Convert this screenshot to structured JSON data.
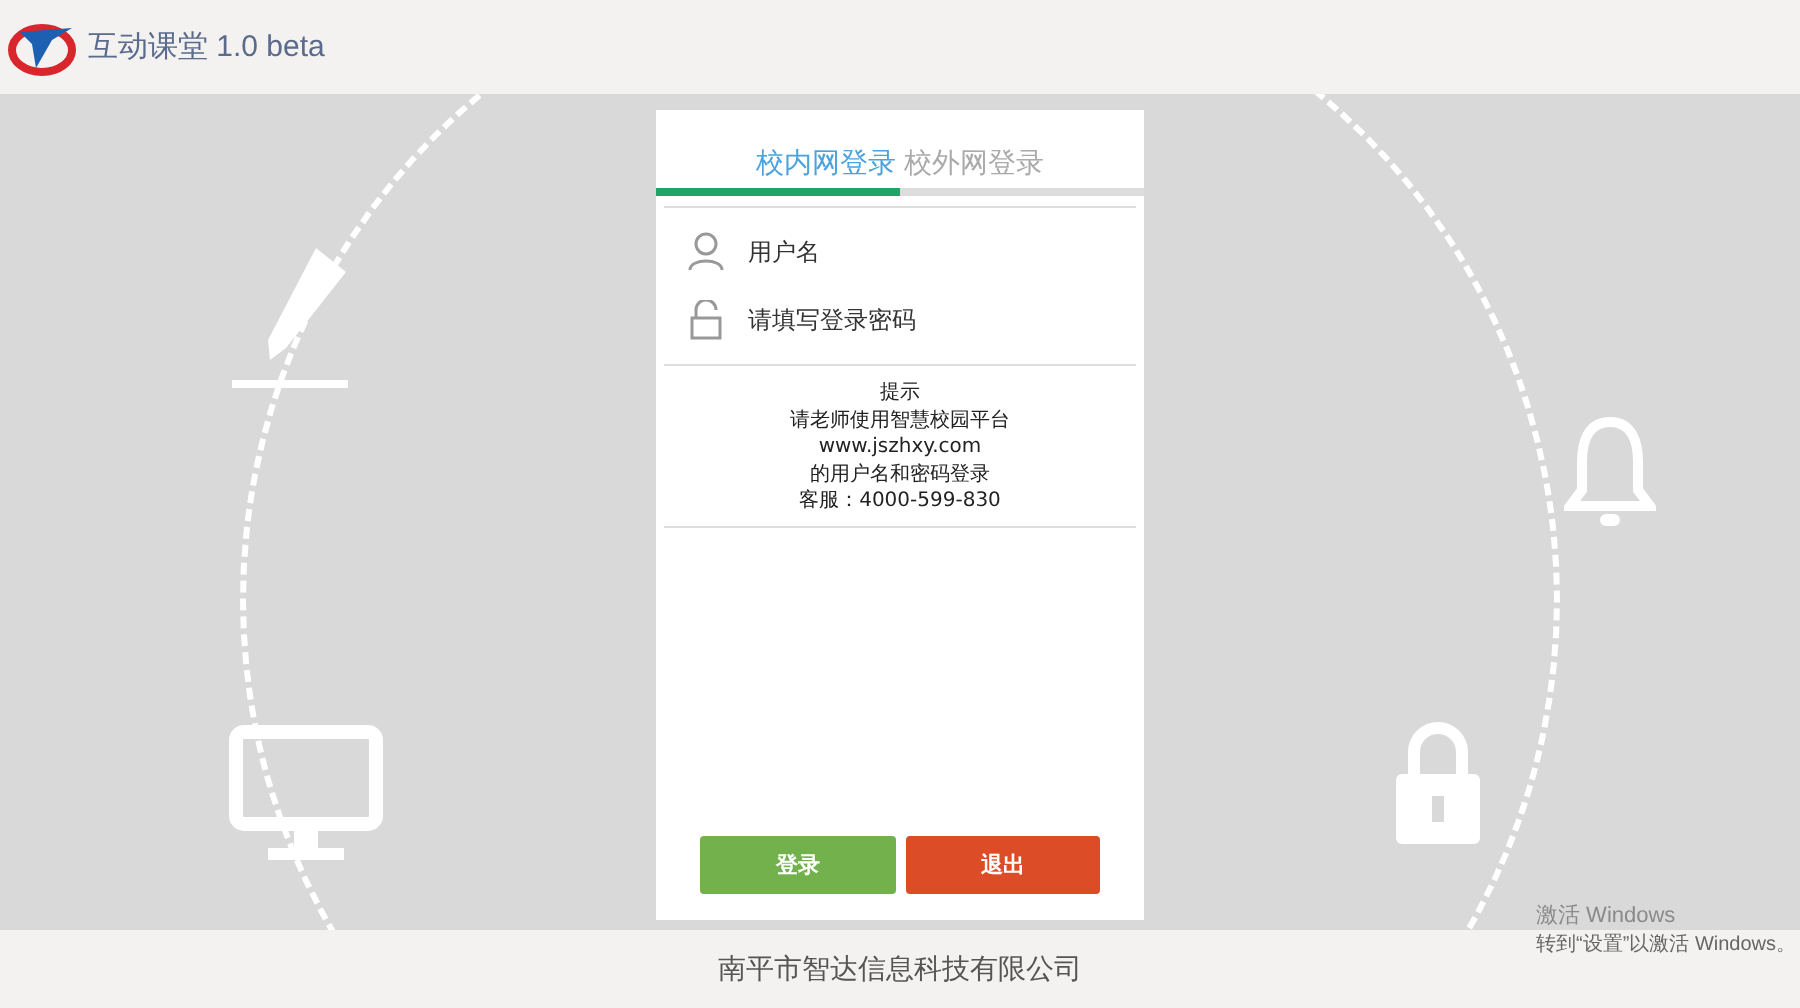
{
  "header": {
    "title": "互动课堂 1.0 beta"
  },
  "login": {
    "tabs": [
      {
        "label": "校内网登录",
        "selected": true
      },
      {
        "label": "校外网登录",
        "selected": false
      }
    ],
    "fields": [
      {
        "kind": "user",
        "placeholder": "用户名"
      },
      {
        "kind": "password",
        "placeholder": "请填写登录密码"
      }
    ],
    "hint": [
      "提示",
      "请老师使用智慧校园平台",
      "www.jszhxy.com",
      "的用户名和密码登录",
      "客服：4000-599-830"
    ],
    "buttons": [
      {
        "kind": "primary",
        "label": "登录"
      },
      {
        "kind": "danger",
        "label": "退出"
      }
    ]
  },
  "footer": {
    "company": "南平市智达信息科技有限公司"
  },
  "activation_notice": {
    "title": "激活 Windows",
    "text": "转到“设置”以激活 Windows。"
  }
}
